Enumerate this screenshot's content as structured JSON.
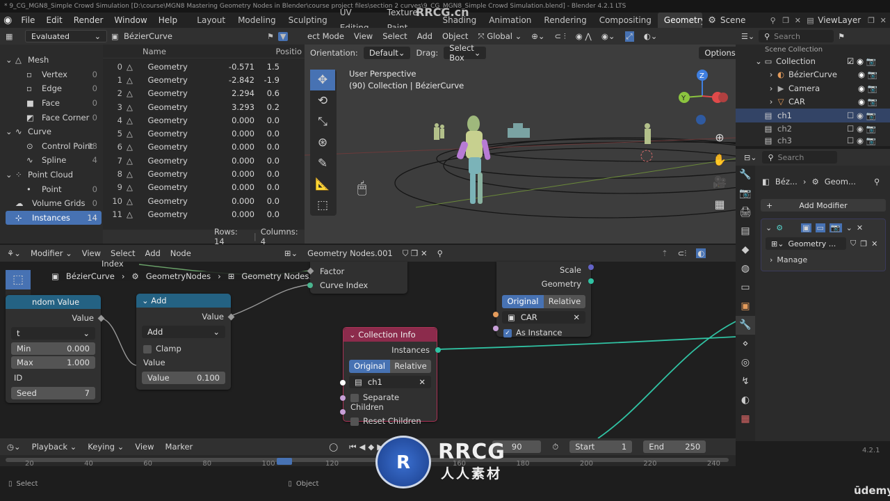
{
  "title_bar": "* 9_CG_MGN8_Simple Crowd Simulation [D:\\course\\MGN8 Mastering Geometry Nodes in Blender\\course project files\\section 2 curves\\9_CG_MGN8_Simple Crowd Simulation.blend] - Blender 4.2.1 LTS",
  "menu": [
    "File",
    "Edit",
    "Render",
    "Window",
    "Help"
  ],
  "workspaces": [
    "Layout",
    "Modeling",
    "Sculpting",
    "UV Editing",
    "Texture Paint",
    "Shading",
    "Animation",
    "Rendering",
    "Compositing",
    "Geometry No"
  ],
  "scene": "Scene",
  "view_layer": "ViewLayer",
  "spreadsheet": {
    "mode": "Evaluated",
    "object": "BézierCurve",
    "col_name": "Name",
    "col_pos": "Positio",
    "tree": [
      {
        "label": "Mesh",
        "count": ""
      },
      {
        "label": "Vertex",
        "count": "0"
      },
      {
        "label": "Edge",
        "count": "0"
      },
      {
        "label": "Face",
        "count": "0"
      },
      {
        "label": "Face Corner",
        "count": "0"
      },
      {
        "label": "Curve",
        "count": ""
      },
      {
        "label": "Control Point",
        "count": "18"
      },
      {
        "label": "Spline",
        "count": "4"
      },
      {
        "label": "Point Cloud",
        "count": ""
      },
      {
        "label": "Point",
        "count": "0"
      },
      {
        "label": "Volume Grids",
        "count": "0"
      },
      {
        "label": "Instances",
        "count": "14"
      }
    ],
    "rows": [
      [
        "0",
        "Geometry",
        "-0.571",
        "1.5"
      ],
      [
        "1",
        "Geometry",
        "-2.842",
        "-1.9"
      ],
      [
        "2",
        "Geometry",
        "2.294",
        "0.6"
      ],
      [
        "3",
        "Geometry",
        "3.293",
        "0.2"
      ],
      [
        "4",
        "Geometry",
        "0.000",
        "0.0"
      ],
      [
        "5",
        "Geometry",
        "0.000",
        "0.0"
      ],
      [
        "6",
        "Geometry",
        "0.000",
        "0.0"
      ],
      [
        "7",
        "Geometry",
        "0.000",
        "0.0"
      ],
      [
        "8",
        "Geometry",
        "0.000",
        "0.0"
      ],
      [
        "9",
        "Geometry",
        "0.000",
        "0.0"
      ],
      [
        "10",
        "Geometry",
        "0.000",
        "0.0"
      ],
      [
        "11",
        "Geometry",
        "0.000",
        "0.0"
      ]
    ],
    "rows_label": "Rows: 14",
    "cols_label": "Columns: 4"
  },
  "viewport": {
    "mode": "ect Mode",
    "menus": [
      "View",
      "Select",
      "Add",
      "Object"
    ],
    "transform": "Global",
    "orientation_label": "Orientation:",
    "orientation": "Default",
    "drag_label": "Drag:",
    "drag": "Select Box",
    "options": "Options",
    "persp": "User Perspective",
    "info": "(90) Collection | BézierCurve",
    "gizmo": {
      "x": "X",
      "y": "Y",
      "z": "Z"
    }
  },
  "outliner": {
    "search": "Search",
    "top": "Scene Collection",
    "items": [
      {
        "label": "Collection"
      },
      {
        "label": "BézierCurve"
      },
      {
        "label": "Camera"
      },
      {
        "label": "CAR"
      },
      {
        "label": "ch1"
      },
      {
        "label": "ch2"
      },
      {
        "label": "ch3"
      }
    ]
  },
  "properties": {
    "search": "Search",
    "crumb1": "Béz...",
    "crumb2": "Geom...",
    "add_modifier": "Add Modifier",
    "modifier": "Geometry ...",
    "manage": "Manage"
  },
  "node_editor": {
    "menus": [
      "Modifier",
      "View",
      "Select",
      "Add",
      "Node"
    ],
    "tree_name": "Geometry Nodes.001",
    "bc": [
      "BézierCurve",
      "GeometryNodes",
      "Geometry Nodes.001"
    ],
    "random": {
      "title": "ndom Value",
      "value": "Value",
      "type": "t",
      "min_l": "Min",
      "min_v": "0.000",
      "max_l": "Max",
      "max_v": "1.000",
      "id": "ID",
      "seed_l": "Seed",
      "seed_v": "7"
    },
    "add": {
      "title": "Add",
      "value": "Value",
      "op": "Add",
      "clamp": "Clamp",
      "in": "Value",
      "val_l": "Value",
      "val_v": "0.100"
    },
    "index": "Index",
    "factor": "Factor",
    "curve_index": "Curve Index",
    "ci": {
      "title": "Collection Info",
      "instances": "Instances",
      "orig": "Original",
      "rel": "Relative",
      "coll": "ch1",
      "sep": "Separate Children",
      "reset": "Reset Children"
    },
    "obj": {
      "scale": "Scale",
      "geometry": "Geometry",
      "orig": "Original",
      "rel": "Relative",
      "obj": "CAR",
      "as_inst": "As Instance"
    }
  },
  "timeline": {
    "menus": [
      "Playback",
      "Keying",
      "View",
      "Marker"
    ],
    "frame": "90",
    "start_l": "Start",
    "start": "1",
    "end_l": "End",
    "end": "250",
    "ticks": [
      "20",
      "40",
      "60",
      "80",
      "100",
      "120",
      "140",
      "160",
      "180",
      "200",
      "220",
      "240"
    ]
  },
  "status": {
    "select": "Select",
    "object": "Object",
    "version": "4.2.1"
  },
  "watermark": {
    "brand": "RRCG",
    "sub": "人人素材",
    "top": "RRCG.cn",
    "udemy": "ūdemy"
  }
}
